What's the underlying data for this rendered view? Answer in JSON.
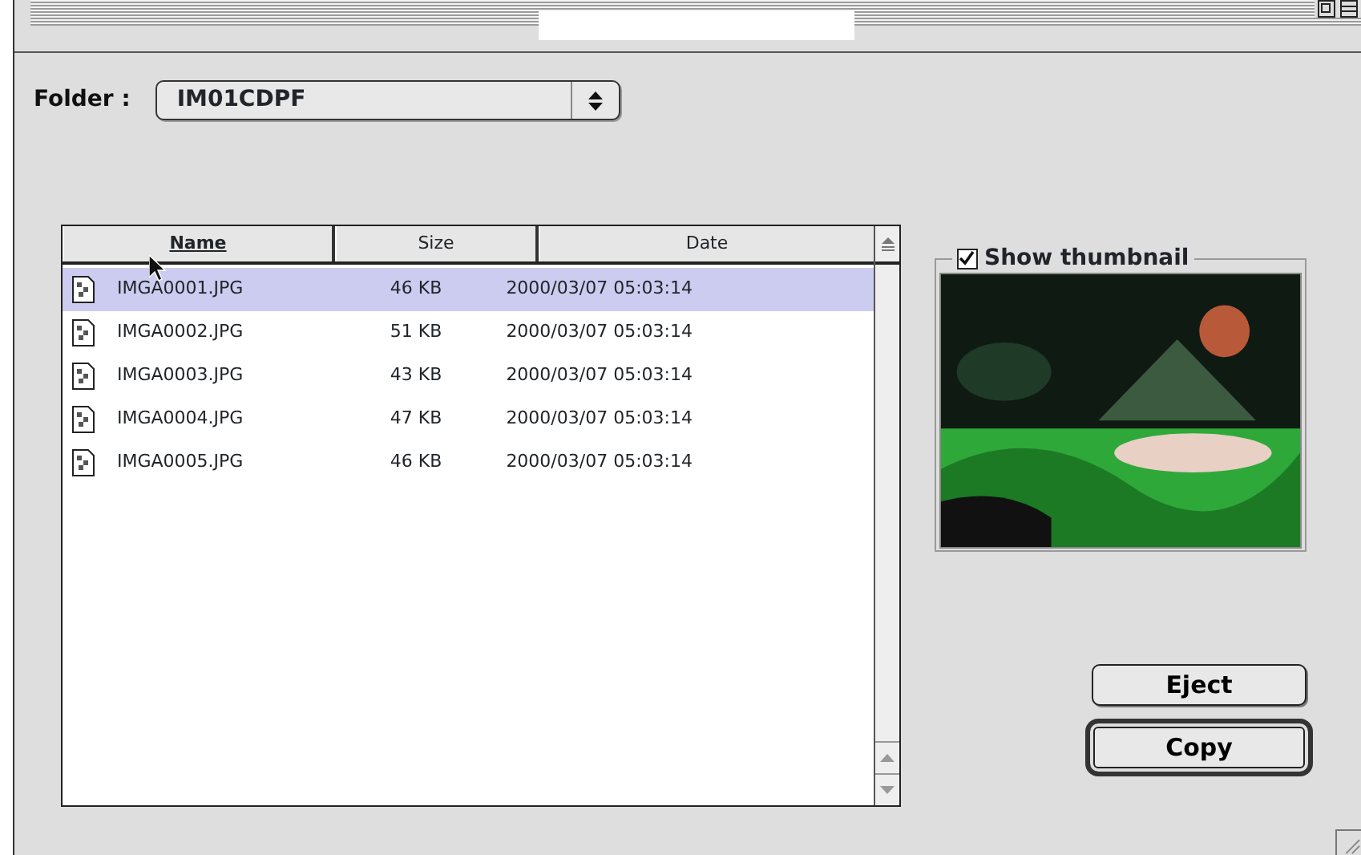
{
  "folder": {
    "label": "Folder :",
    "value": "IM01CDPF"
  },
  "table": {
    "columns": [
      {
        "label": "Name",
        "sorted": true
      },
      {
        "label": "Size",
        "sorted": false
      },
      {
        "label": "Date",
        "sorted": false
      }
    ],
    "rows": [
      {
        "name": "IMGA0001.JPG",
        "size": "46 KB",
        "date": "2000/03/07 05:03:14",
        "selected": true
      },
      {
        "name": "IMGA0002.JPG",
        "size": "51 KB",
        "date": "2000/03/07 05:03:14",
        "selected": false
      },
      {
        "name": "IMGA0003.JPG",
        "size": "43 KB",
        "date": "2000/03/07 05:03:14",
        "selected": false
      },
      {
        "name": "IMGA0004.JPG",
        "size": "47 KB",
        "date": "2000/03/07 05:03:14",
        "selected": false
      },
      {
        "name": "IMGA0005.JPG",
        "size": "46 KB",
        "date": "2000/03/07 05:03:14",
        "selected": false
      }
    ]
  },
  "thumbnail": {
    "label": "Show thumbnail",
    "checked": true,
    "kind": "picture"
  },
  "buttons": [
    {
      "label": "Eject",
      "default": false
    },
    {
      "label": "Copy",
      "default": true
    }
  ]
}
